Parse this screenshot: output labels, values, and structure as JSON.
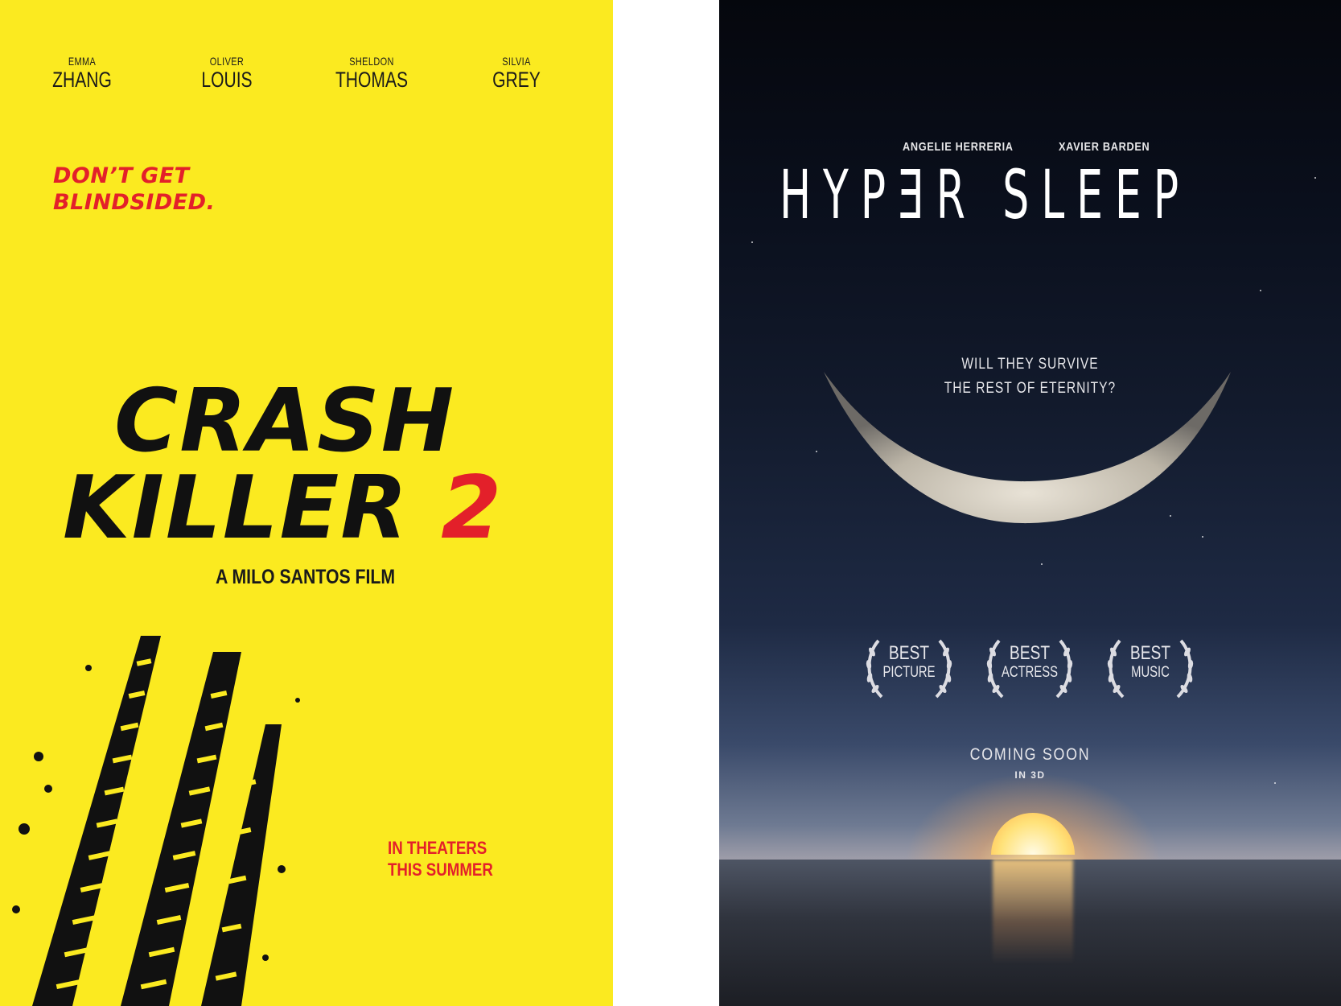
{
  "poster_crash_killer": {
    "colors": {
      "background": "#fbea20",
      "accent": "#e3202a",
      "ink": "#111111"
    },
    "cast": [
      {
        "first": "EMMA",
        "last": "ZHANG"
      },
      {
        "first": "OLIVER",
        "last": "LOUIS"
      },
      {
        "first": "SHELDON",
        "last": "THOMAS"
      },
      {
        "first": "SILVIA",
        "last": "GREY"
      }
    ],
    "tagline": {
      "line1": "DON’T GET",
      "line2": "BLINDSIDED."
    },
    "title": {
      "line1": "CRASH",
      "line2": "KILLER",
      "number": "2"
    },
    "director_credit": "A MILO SANTOS FILM",
    "release": {
      "line1": "IN THEATERS",
      "line2": "THIS SUMMER"
    },
    "artwork": "tire-tracks-icon"
  },
  "poster_hypersleep": {
    "colors": {
      "sky_top": "#05070d",
      "sky_horizon": "#a6a3ad",
      "text": "#ffffff"
    },
    "cast": [
      "ANGELIE HERRERIA",
      "XAVIER BARDEN"
    ],
    "title": "HYPƎR SLEEP",
    "question": {
      "line1": "WILL THEY SURVIVE",
      "line2": "THE REST OF ETERNITY?"
    },
    "awards": [
      {
        "line1": "BEST",
        "line2": "PICTURE"
      },
      {
        "line1": "BEST",
        "line2": "ACTRESS"
      },
      {
        "line1": "BEST",
        "line2": "MUSIC"
      }
    ],
    "release": {
      "main": "COMING SOON",
      "sub": "IN 3D"
    },
    "artwork": [
      "crescent-moon-icon",
      "sunset-icon",
      "laurel-wreath-icon"
    ]
  }
}
